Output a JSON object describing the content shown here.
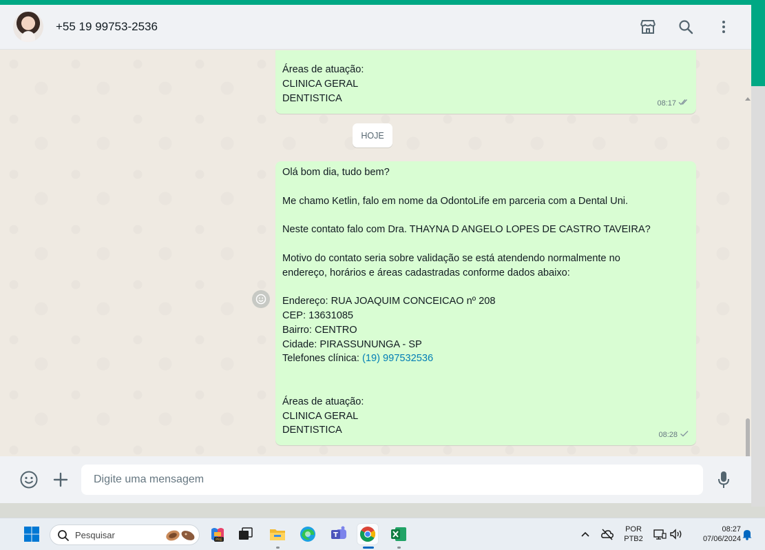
{
  "header": {
    "contact_name": "+55 19 99753-2536"
  },
  "chat": {
    "messages": [
      {
        "lines": [
          "Áreas de atuação:",
          "CLINICA GERAL",
          "DENTISTICA"
        ],
        "time": "08:17",
        "status": "double-check-icon"
      },
      {
        "lines": [
          "Olá bom dia, tudo bem?",
          "",
          "Me chamo Ketlin, falo em nome da OdontoLife em parceria com a Dental Uni.",
          "",
          "Neste contato falo com Dra. THAYNA D ANGELO LOPES DE CASTRO TAVEIRA?",
          "",
          "Motivo do contato seria sobre validação se está atendendo normalmente no",
          "endereço, horários e áreas cadastradas conforme dados abaixo:",
          "",
          "Endereço: RUA JOAQUIM CONCEICAO nº 208",
          "CEP: 13631085",
          "Bairro: CENTRO",
          "Cidade: PIRASSUNUNGA - SP",
          "",
          "",
          "",
          "Áreas de atuação:",
          "CLINICA GERAL",
          "DENTISTICA"
        ],
        "phone_label": "Telefones clínica: ",
        "phone_link": "(19) 997532536",
        "time": "08:28",
        "status": "single-check-icon"
      }
    ],
    "date_separator": "HOJE"
  },
  "composer": {
    "placeholder": "Digite uma mensagem"
  },
  "taskbar": {
    "search_label": "Pesquisar",
    "lang_top": "POR",
    "lang_bottom": "PTB2",
    "time": "08:27",
    "date": "07/06/2024"
  },
  "colors": {
    "accent": "#00a884",
    "outgoing_bubble": "#d9fdd3",
    "chat_bg": "#efeae2",
    "link": "#027eb5"
  }
}
